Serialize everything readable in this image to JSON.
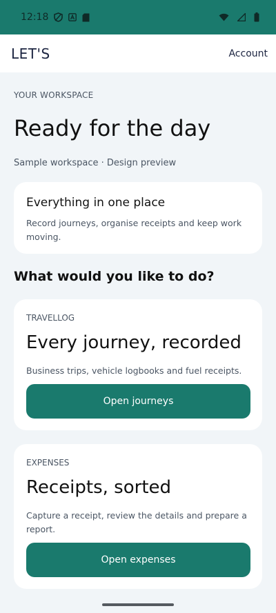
{
  "status_bar": {
    "time": "12:18",
    "icons_left": [
      "privacy-shield-icon",
      "a-badge-icon",
      "sd-card-icon"
    ],
    "icons_right": [
      "wifi-icon",
      "cell-signal-icon",
      "battery-icon"
    ]
  },
  "app_bar": {
    "brand": "LET'S",
    "account_label": "Account"
  },
  "hero": {
    "eyebrow": "YOUR WORKSPACE",
    "title": "Ready for the day",
    "subtitle": "Sample workspace · Design preview"
  },
  "intro_card": {
    "title": "Everything in one place",
    "body": "Record journeys, organise receipts and keep work moving."
  },
  "section_heading": "What would you like to do?",
  "cards": [
    {
      "eyebrow": "TRAVELLOG",
      "title": "Every journey, recorded",
      "body": "Business trips, vehicle logbooks and fuel receipts.",
      "button_label": "Open journeys"
    },
    {
      "eyebrow": "EXPENSES",
      "title": "Receipts, sorted",
      "body": "Capture a receipt, review the details and prepare a report.",
      "button_label": "Open expenses"
    }
  ],
  "colors": {
    "accent": "#1a7a6d",
    "background": "#f1f5f8",
    "card": "#ffffff",
    "text_primary": "#111111",
    "text_secondary": "#4a5563"
  }
}
